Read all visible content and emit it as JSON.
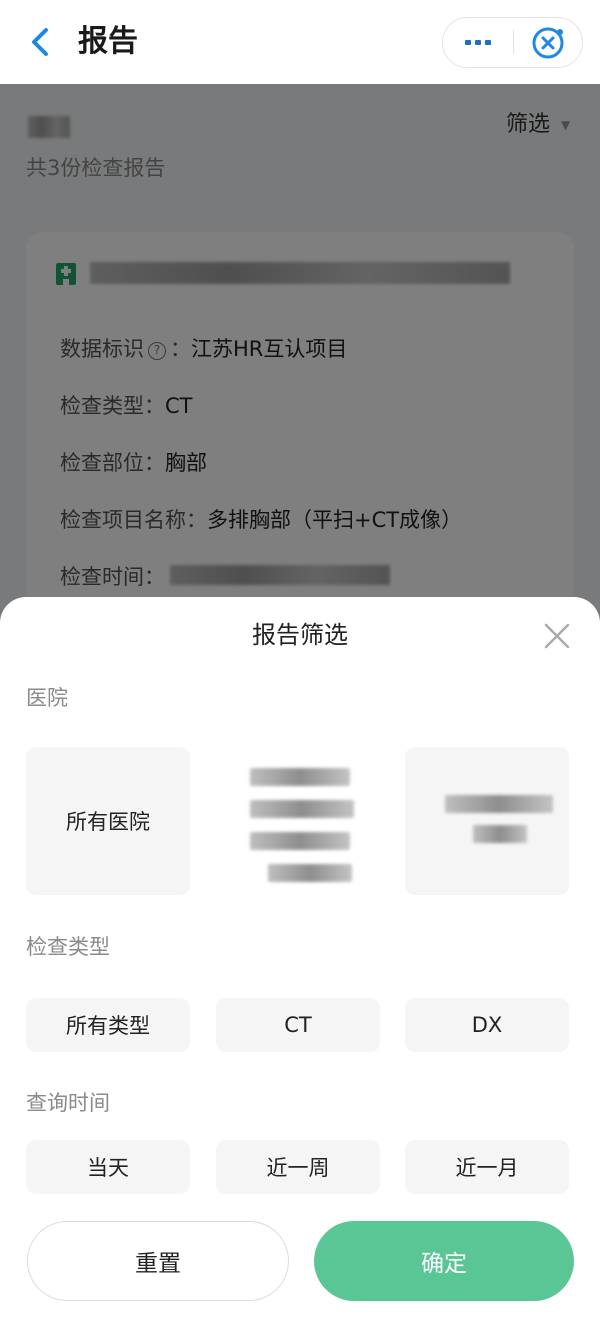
{
  "header": {
    "title": "报告"
  },
  "background": {
    "filter_label": "筛选",
    "report_count": "共3份检查报告",
    "card": {
      "fields": [
        {
          "label": "数据标识",
          "value": "江苏HR互认项目"
        },
        {
          "label": "检查类型：",
          "value": "CT"
        },
        {
          "label": "检查部位：",
          "value": "胸部"
        },
        {
          "label": "检查项目名称：",
          "value": "多排胸部（平扫+CT成像）"
        },
        {
          "label": "检查时间：",
          "value": ""
        }
      ]
    }
  },
  "sheet": {
    "title": "报告筛选",
    "hospital": {
      "label": "医院",
      "options": [
        "所有医院"
      ]
    },
    "type": {
      "label": "检查类型",
      "options": [
        "所有类型",
        "CT",
        "DX"
      ]
    },
    "time": {
      "label": "查询时间",
      "options": [
        "当天",
        "近一周",
        "近一月"
      ]
    },
    "reset_label": "重置",
    "confirm_label": "确定"
  },
  "colors": {
    "accent": "#5ac595",
    "link": "#1e88e5"
  }
}
